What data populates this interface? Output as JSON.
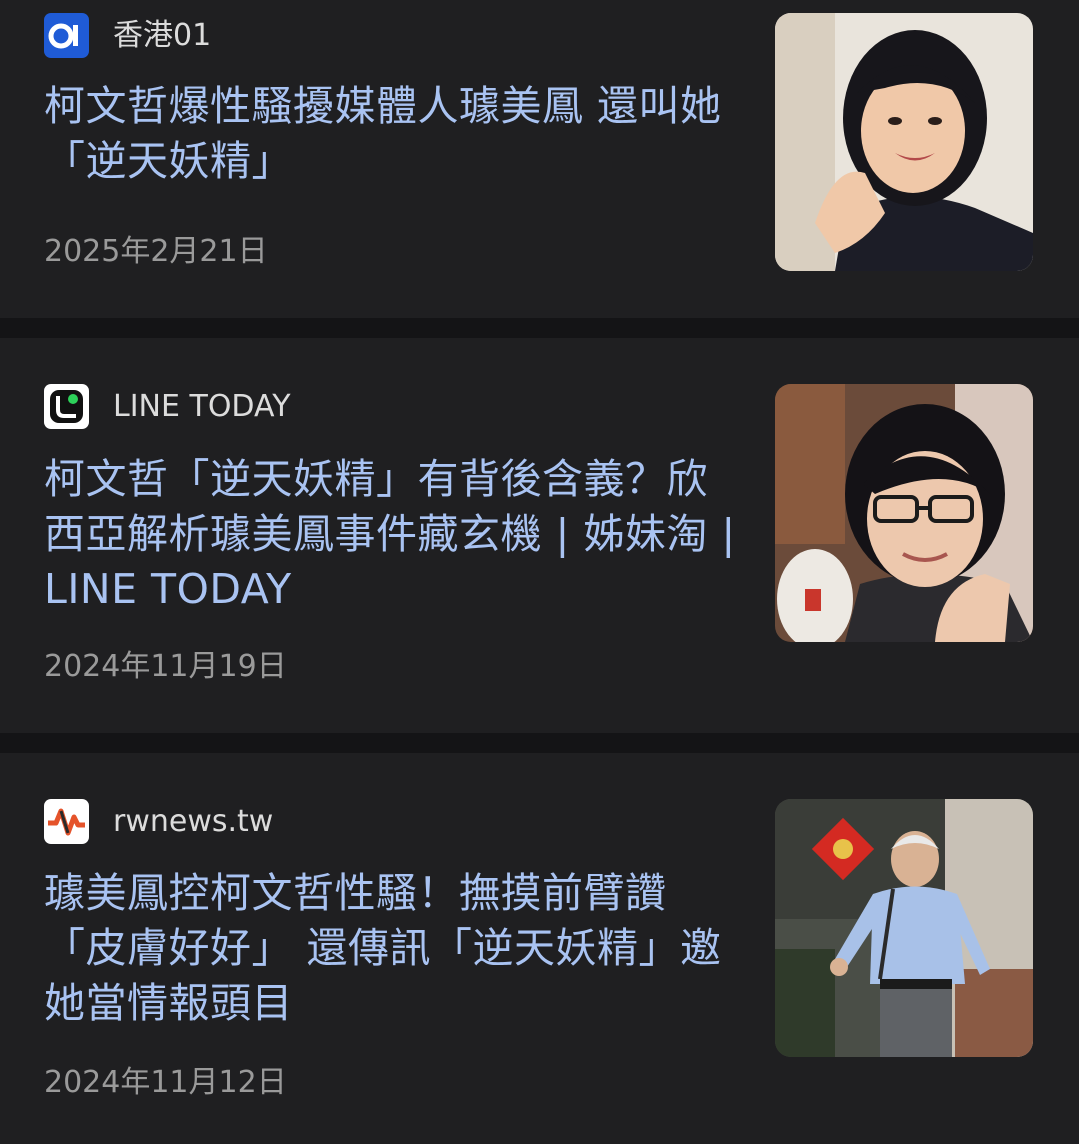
{
  "articles": [
    {
      "source": "香港01",
      "source_icon": "hk01-logo-icon",
      "headline": "柯文哲爆性騷擾媒體人璩美鳳 還叫她「逆天妖精」",
      "date": "2025年2月21日",
      "thumbnail": "woman-portrait-thumbnail"
    },
    {
      "source": "LINE TODAY",
      "source_icon": "line-today-logo-icon",
      "headline": "柯文哲「逆天妖精」有背後含義？欣西亞解析璩美鳳事件藏玄機 | 姊妹淘 | LINE TODAY",
      "date": "2024年11月19日",
      "thumbnail": "woman-glasses-portrait-thumbnail"
    },
    {
      "source": "rwnews.tw",
      "source_icon": "rwnews-logo-icon",
      "headline": "璩美鳳控柯文哲性騷！撫摸前臂讚「皮膚好好」 還傳訊「逆天妖精」邀她當情報頭目",
      "date": "2024年11月12日",
      "thumbnail": "man-walking-photo-thumbnail"
    }
  ],
  "colors": {
    "background": "#141416",
    "card": "#1f1f21",
    "headline": "#a9c3f2",
    "source": "#dcdcdc",
    "date": "#9a9a9a"
  }
}
